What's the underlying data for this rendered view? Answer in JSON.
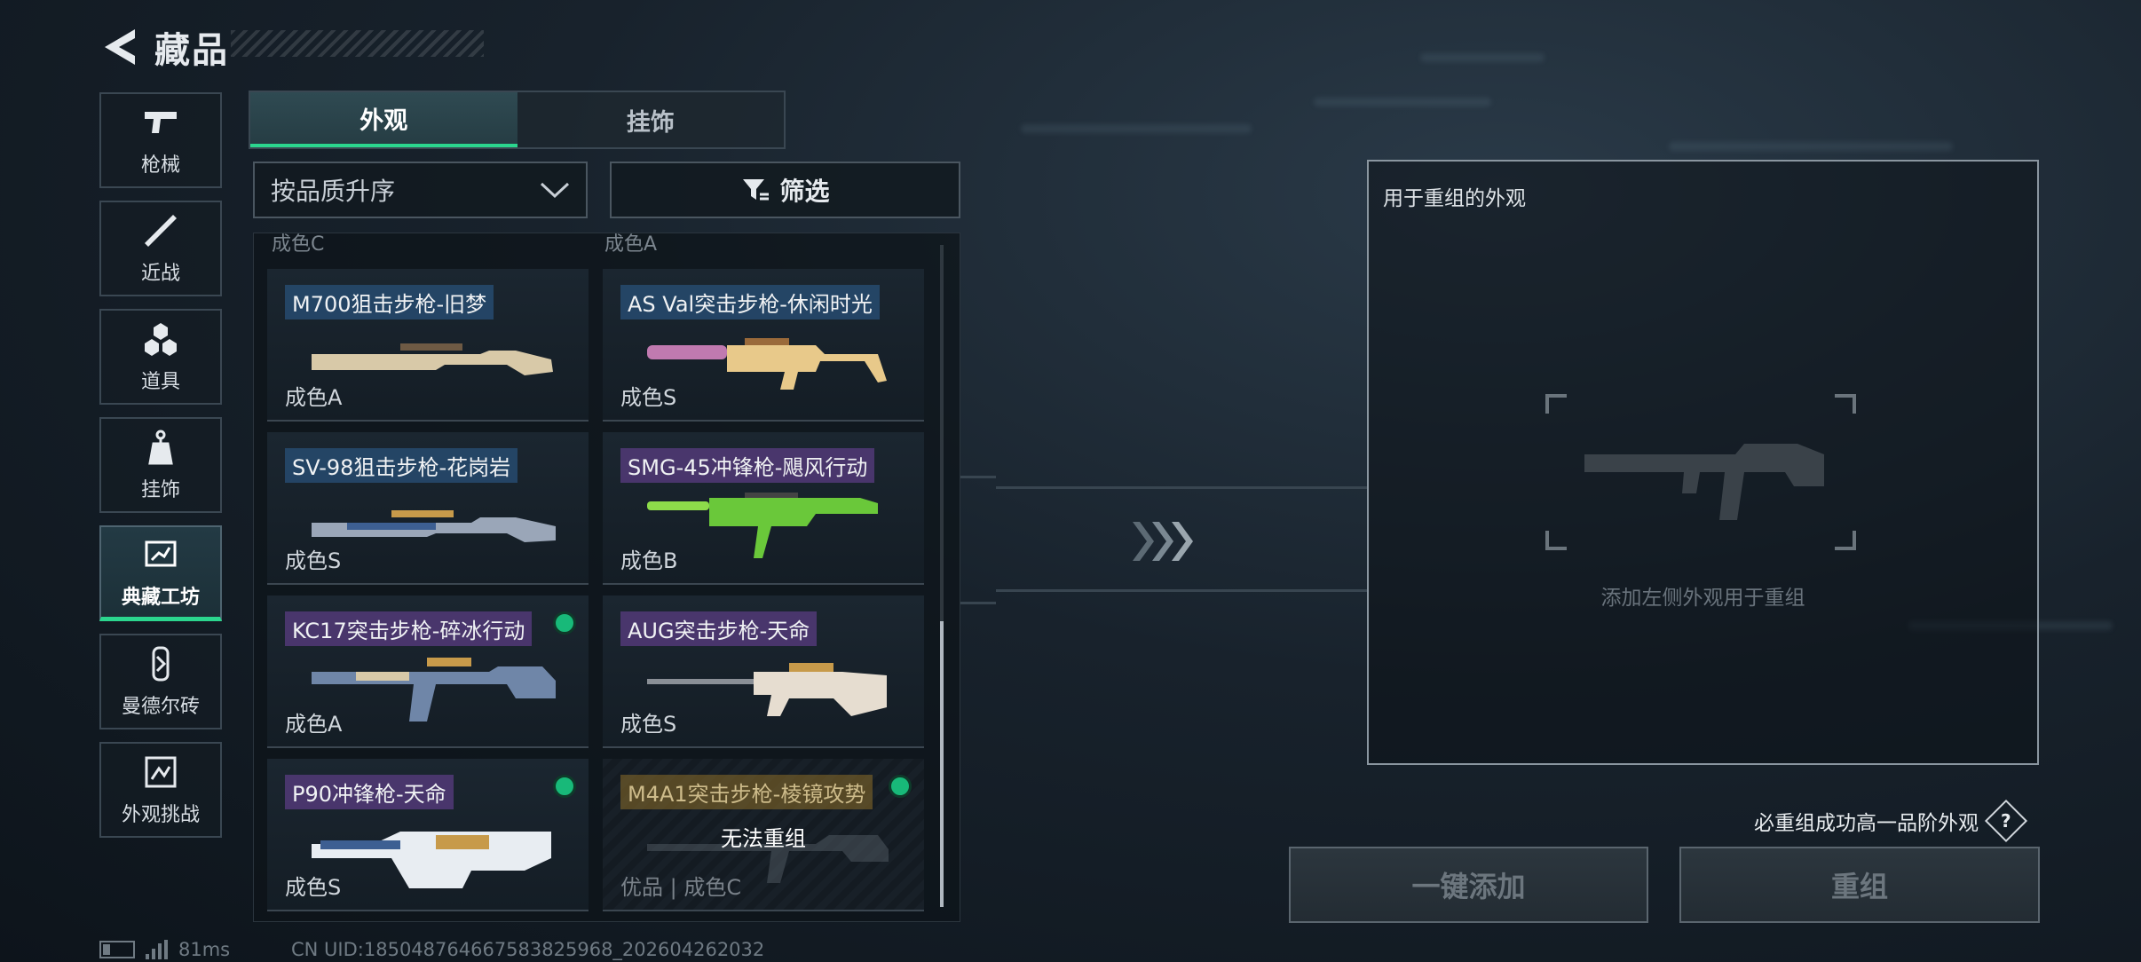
{
  "header": {
    "title": "藏品"
  },
  "sidebar": {
    "items": [
      {
        "label": "枪械",
        "icon": "pistol-icon"
      },
      {
        "label": "近战",
        "icon": "knife-icon"
      },
      {
        "label": "道具",
        "icon": "items-icon"
      },
      {
        "label": "挂饰",
        "icon": "charm-icon"
      },
      {
        "label": "典藏工坊",
        "icon": "workshop-icon",
        "active": true
      },
      {
        "label": "曼德尔砖",
        "icon": "brick-icon"
      },
      {
        "label": "外观挑战",
        "icon": "challenge-icon"
      }
    ]
  },
  "tabs": [
    {
      "label": "外观",
      "active": true
    },
    {
      "label": "挂饰"
    }
  ],
  "sort": {
    "value": "按品质升序"
  },
  "filter": {
    "label": "筛选"
  },
  "list": {
    "partial_top": [
      "成色C",
      "成色A"
    ],
    "cards": [
      {
        "name": "M700狙击步枪-旧梦",
        "grade": "成色A",
        "tier": "blue",
        "selected": false,
        "disabled": false
      },
      {
        "name": "AS Val突击步枪-休闲时光",
        "grade": "成色S",
        "tier": "blue",
        "selected": false,
        "disabled": false
      },
      {
        "name": "SV-98狙击步枪-花岗岩",
        "grade": "成色S",
        "tier": "blue",
        "selected": false,
        "disabled": false
      },
      {
        "name": "SMG-45冲锋枪-飓风行动",
        "grade": "成色B",
        "tier": "purple",
        "selected": false,
        "disabled": false
      },
      {
        "name": "KC17突击步枪-碎冰行动",
        "grade": "成色A",
        "tier": "purple",
        "selected": true,
        "disabled": false
      },
      {
        "name": "AUG突击步枪-天命",
        "grade": "成色S",
        "tier": "purple",
        "selected": false,
        "disabled": false
      },
      {
        "name": "P90冲锋枪-天命",
        "grade": "成色S",
        "tier": "purple",
        "selected": true,
        "disabled": false
      },
      {
        "name": "M4A1突击步枪-棱镜攻势",
        "grade": "优品 | 成色C",
        "tier": "gold",
        "selected": true,
        "disabled": true,
        "overlay": "无法重组"
      }
    ]
  },
  "remix": {
    "title": "用于重组的外观",
    "hint": "添加左侧外观用于重组",
    "guarantee": "必重组成功高一品阶外观",
    "help": "?"
  },
  "buttons": {
    "add_all": "一键添加",
    "remix": "重组"
  },
  "status": {
    "ping": "81ms",
    "uid": "CN UID:185048764667583825968_202604262032"
  },
  "colors": {
    "accent": "#2bd68e",
    "selected_dot": "#18b979"
  }
}
